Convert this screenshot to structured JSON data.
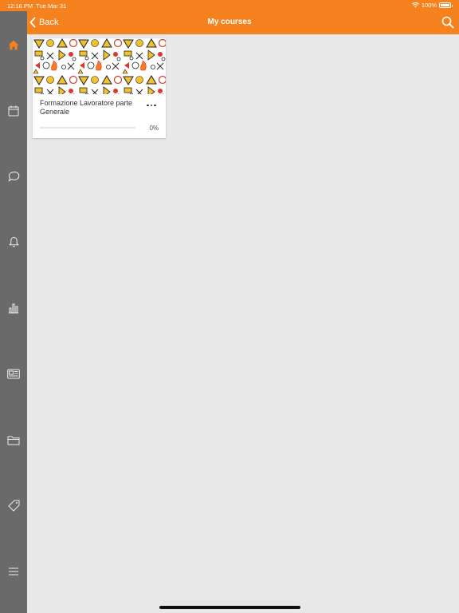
{
  "status_bar": {
    "time": "12:16 PM",
    "date": "Tue Mar 31",
    "battery": "100%"
  },
  "header": {
    "back_label": "Back",
    "title": "My courses"
  },
  "sidebar": {
    "items": [
      {
        "icon": "home-icon",
        "active": true
      },
      {
        "icon": "calendar-icon"
      },
      {
        "icon": "chat-icon"
      },
      {
        "icon": "bell-icon"
      },
      {
        "icon": "bar-chart-icon"
      },
      {
        "icon": "newspaper-icon"
      },
      {
        "icon": "folder-icon"
      },
      {
        "icon": "tag-icon"
      },
      {
        "icon": "menu-icon"
      }
    ]
  },
  "courses": [
    {
      "title": "Formazione Lavoratore parte Generale",
      "progress_label": "0%",
      "progress": 0
    }
  ],
  "colors": {
    "accent": "#f6821f",
    "sidebar": "#6a6a6a",
    "background": "#e8e8e8"
  }
}
